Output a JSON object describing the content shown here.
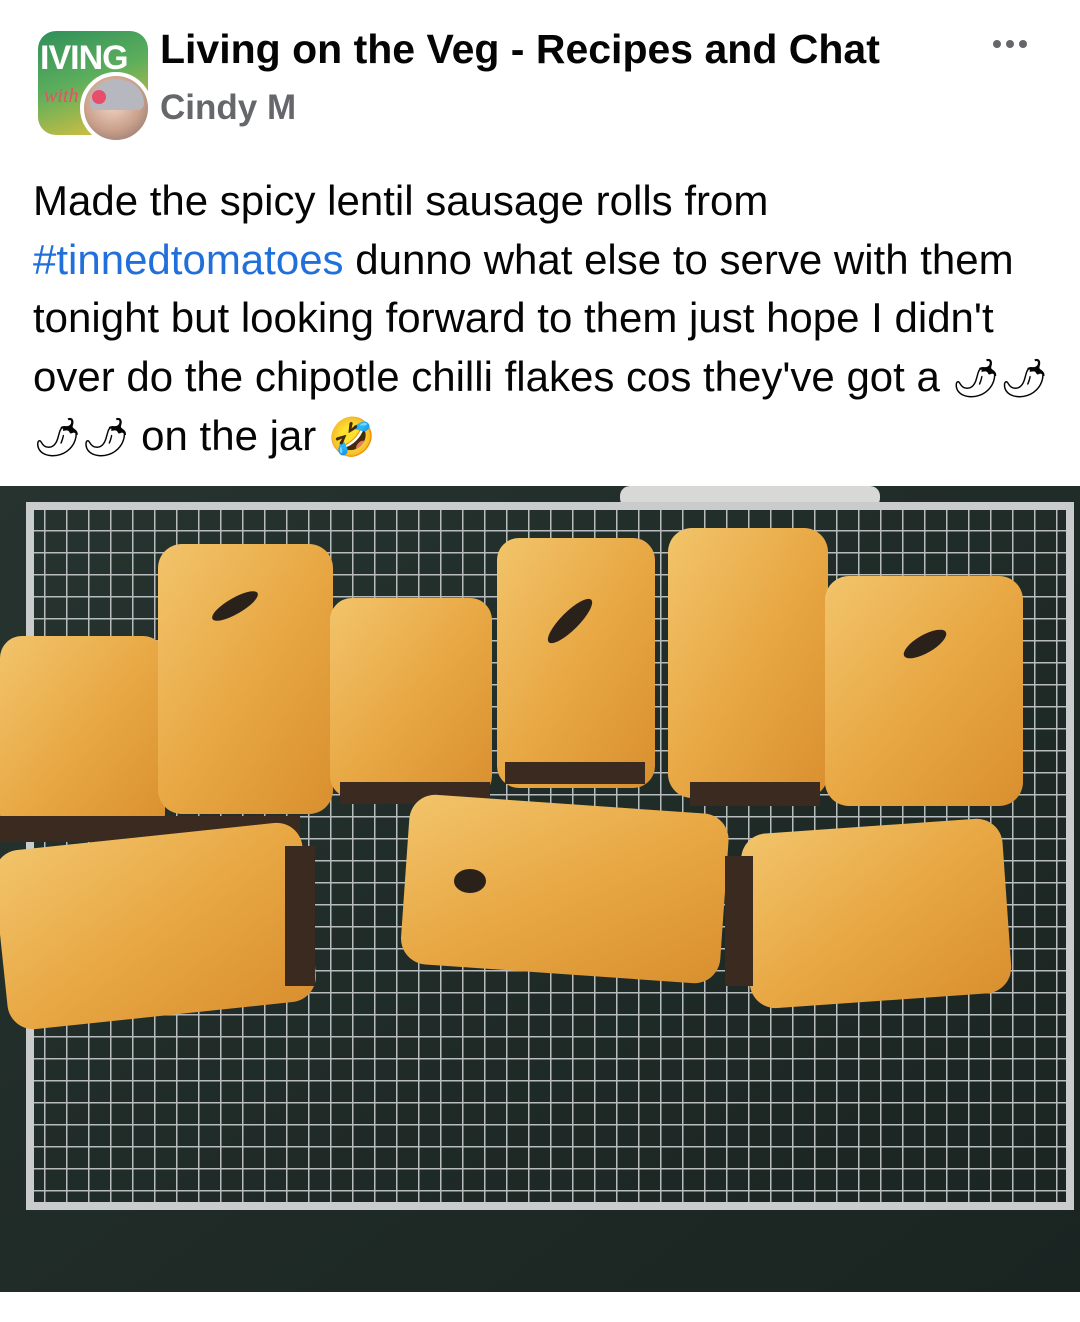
{
  "post": {
    "group_name": "Living on the Veg - Recipes and Chat",
    "author": "Cindy M",
    "group_logo_text": "IVING",
    "group_logo_sub": "with",
    "text_before_hashtag": "Made the spicy lentil sausage rolls from ",
    "hashtag": "#tinnedtomatoes",
    "text_after_hashtag": " dunno what else to serve with them tonight but looking forward to them just hope I didn't over do the chipotle chilli flakes  cos they've got a ",
    "chilli_emojis": "🌶🌶🌶🌶",
    "text_end": " on the jar ",
    "laugh_emoji": "🤣",
    "more_icon": "ellipsis-icon"
  },
  "colors": {
    "hashtag": "#216fdb",
    "secondary_text": "#65676b"
  }
}
